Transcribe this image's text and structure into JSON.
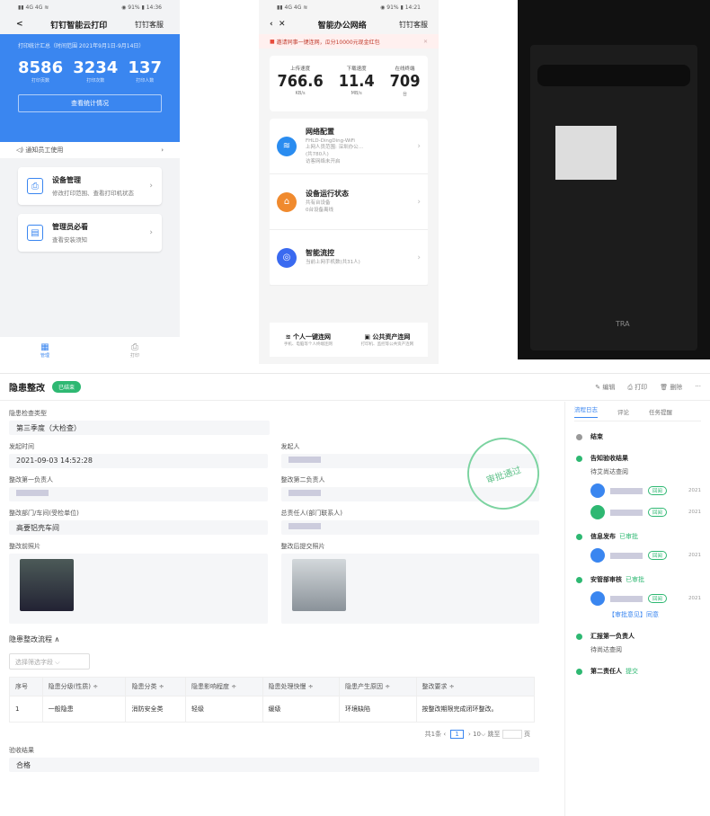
{
  "phone1": {
    "status_left": "▮▮ 4G 4G ≋",
    "status_right": "◉ 91% ▮ 14:36",
    "back": "<",
    "title": "钉钉智能云打印",
    "service": "钉钉客服",
    "summary": "打印统计汇总（时间范围 2021年9月1日-9月14日）",
    "stats": [
      {
        "num": "8586",
        "label": "打印页数"
      },
      {
        "num": "3234",
        "label": "打印次数"
      },
      {
        "num": "137",
        "label": "打印人数"
      }
    ],
    "view_btn": "查看统计情况",
    "notice": "通知员工使用",
    "cards": [
      {
        "title": "设备管理",
        "sub": "修改打印范围、查看打印机状态",
        "icon": "printer-icon"
      },
      {
        "title": "管理员必看",
        "sub": "查看安装须知",
        "icon": "document-icon"
      }
    ],
    "tabs": [
      "管理",
      "打印"
    ]
  },
  "phone2": {
    "status_left": "▮▮ 4G 4G ≋",
    "status_right": "◉ 91% ▮ 14:21",
    "title": "智能办公网络",
    "service": "钉钉客服",
    "banner": "邀请同事一键连网，瓜分10000元现金红包",
    "speeds": [
      {
        "label": "上传速度",
        "num": "766.6",
        "unit": "KB/s"
      },
      {
        "label": "下载速度",
        "num": "11.4",
        "unit": "MB/s"
      },
      {
        "label": "在线终端",
        "num": "709",
        "unit": "台"
      }
    ],
    "items": [
      {
        "title": "网络配置",
        "sub": "FHLD-DingDing-WiFi\n上网人员范围: 深圳办公…\n(共780人)\n访客网络未开启",
        "color": "#2a8cf0",
        "icon": "wifi-icon"
      },
      {
        "title": "设备运行状态",
        "sub": "共有台设备\n0台设备离线",
        "color": "#f08a2e",
        "icon": "router-icon"
      },
      {
        "title": "智能流控",
        "sub": "当前上网手机数(共31人)",
        "color": "#3a6af0",
        "icon": "flow-icon"
      }
    ],
    "bottom": [
      {
        "title": "个人一键连网",
        "sub": "手机、电脑等个人终端连网"
      },
      {
        "title": "公共资产连网",
        "sub": "打印机、监控等公共资产连网"
      }
    ]
  },
  "photo": {
    "brand": "TRA"
  },
  "app": {
    "title": "隐患整改",
    "tag": "已结束",
    "tools": [
      "编辑",
      "打印",
      "删除",
      "···"
    ],
    "fields": {
      "type_label": "隐患检查类型",
      "type_value": "第三季度（大检查）",
      "time_label": "发起时间",
      "time_value": "2021-09-03 14:52:28",
      "initiator_label": "发起人",
      "owner1_label": "整改第一负责人",
      "owner2_label": "整改第二负责人",
      "dept_label": "整改部门/车间(受检单位)",
      "dept_value": "高要铝壳车间",
      "chief_label": "总责任人(部门联系人)",
      "before_label": "整改前照片",
      "after_label": "整改后提交照片"
    },
    "stamp": "审批通过",
    "flow_title": "隐患整改流程 ∧",
    "select_ph": "选择筛选字段",
    "table": {
      "headers": [
        "序号",
        "隐患分级(性质) ÷",
        "隐患分类 ÷",
        "隐患影响程度 ÷",
        "隐患处理快慢 ÷",
        "隐患产生原因 ÷",
        "整改要求 ÷"
      ],
      "row": [
        "1",
        "一般隐患",
        "消防安全类",
        "轻级",
        "缓级",
        "环境缺陷",
        "按整改期限完成闭环整改。"
      ]
    },
    "pager": {
      "total": "共1条",
      "page": "1",
      "size": "10",
      "jump": "跳至",
      "unit": "页"
    },
    "result_label": "验收结果",
    "result_value": "合格",
    "right": {
      "tabs": [
        "流程日志",
        "评论",
        "任务提醒"
      ],
      "nodes": [
        {
          "name": "结束",
          "status": ""
        },
        {
          "name": "告知验收结果",
          "status": "",
          "sub": "待艾尚达查阅"
        },
        {
          "name": "信息发布",
          "status": "已审批"
        },
        {
          "name": "安管部审核",
          "status": "已审批",
          "sub": "【审批意见】同意"
        },
        {
          "name": "汇报第一负责人",
          "status": "",
          "sub": "待尚达查阅"
        },
        {
          "name": "第二责任人",
          "status": "提交"
        }
      ],
      "badge": "回阅",
      "year": "2021"
    }
  }
}
